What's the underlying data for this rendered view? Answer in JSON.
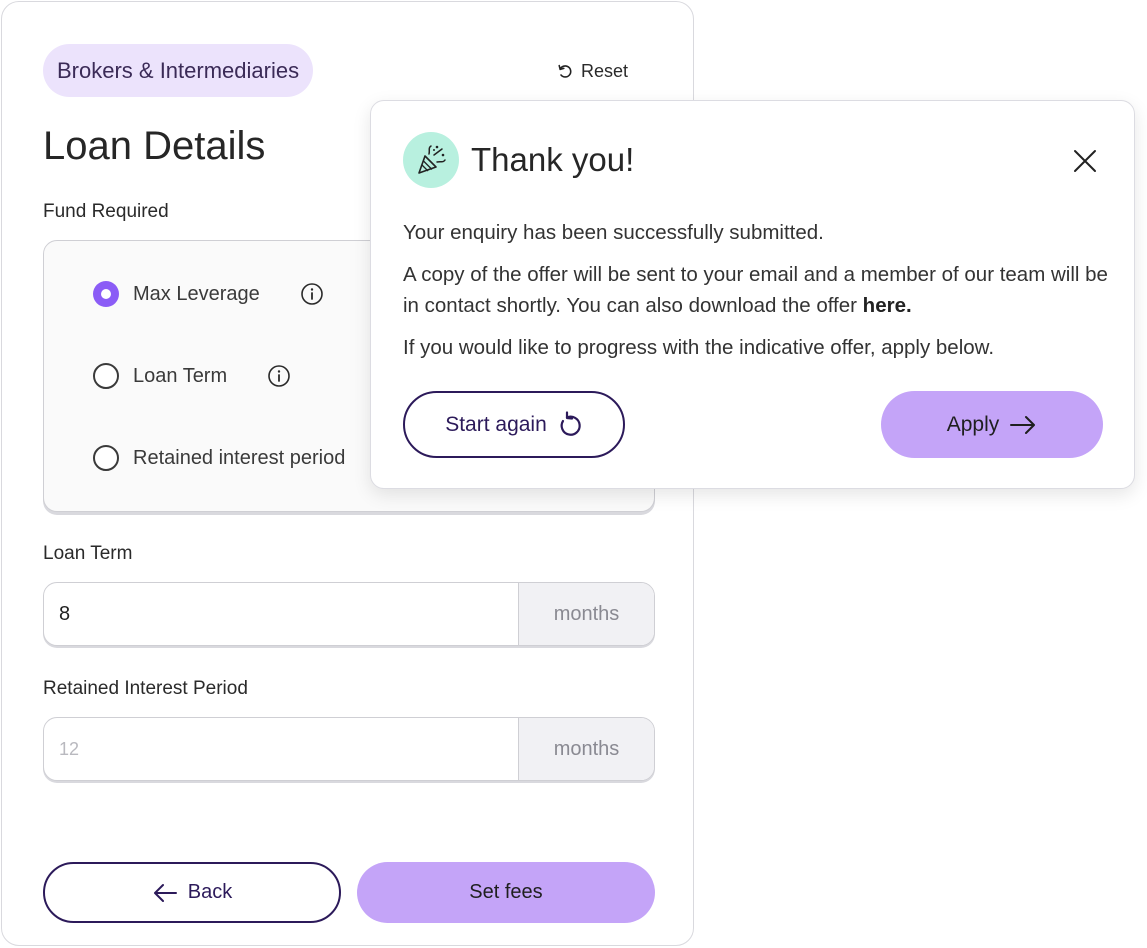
{
  "form": {
    "badge": "Brokers & Intermediaries",
    "reset_label": "Reset",
    "title": "Loan Details",
    "fund_required_label": "Fund Required",
    "options": [
      {
        "label": "Max Leverage",
        "checked": true
      },
      {
        "label": "Loan Term",
        "checked": false
      },
      {
        "label": "Retained interest period",
        "checked": false
      }
    ],
    "loan_term": {
      "label": "Loan Term",
      "value": "8",
      "unit": "months"
    },
    "retained_interest": {
      "label": "Retained Interest Period",
      "placeholder": "12",
      "unit": "months"
    },
    "back_label": "Back",
    "set_fees_label": "Set fees"
  },
  "modal": {
    "title": "Thank you!",
    "line1": "Your enquiry has been successfully submitted.",
    "line2": "A copy of the offer will be sent to your email and a member of our team will be in contact shortly. You can also download the offer",
    "link_label": "here.",
    "line3": "If you would like to progress with the indicative offer, apply below.",
    "start_again_label": "Start again",
    "apply_label": "Apply"
  },
  "colors": {
    "accent": "#8b5cf6",
    "button_fill": "#c4a4f8",
    "dark_outline": "#2c1a5a",
    "badge_bg": "#ece3fc",
    "icon_bg": "#b8f0df"
  }
}
